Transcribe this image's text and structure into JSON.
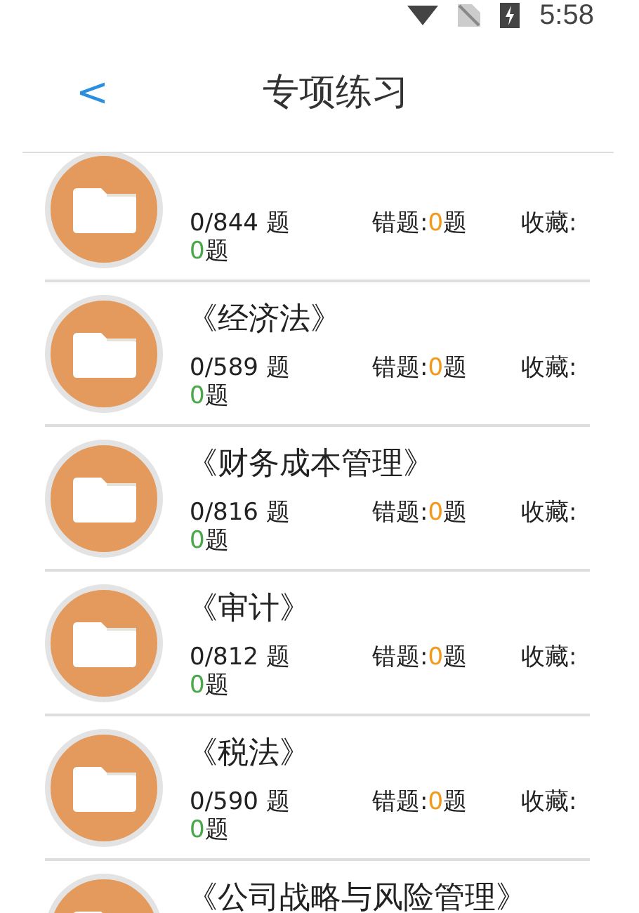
{
  "status_bar": {
    "time": "5:58"
  },
  "header": {
    "back": "<",
    "title": "专项练习"
  },
  "subjects": [
    {
      "done": "0/844 题",
      "wrong": {
        "label": "错题:",
        "count": "0",
        "unit": "题"
      },
      "favorites": {
        "label": "收藏:",
        "count": "0",
        "unit": "题"
      }
    },
    {
      "title": "《经济法》",
      "done": "0/589 题",
      "wrong": {
        "label": "错题:",
        "count": "0",
        "unit": "题"
      },
      "favorites": {
        "label": "收藏:",
        "count": "0",
        "unit": "题"
      }
    },
    {
      "title": "《财务成本管理》",
      "done": "0/816 题",
      "wrong": {
        "label": "错题:",
        "count": "0",
        "unit": "题"
      },
      "favorites": {
        "label": "收藏:",
        "count": "0",
        "unit": "题"
      }
    },
    {
      "title": "《审计》",
      "done": "0/812 题",
      "wrong": {
        "label": "错题:",
        "count": "0",
        "unit": "题"
      },
      "favorites": {
        "label": "收藏:",
        "count": "0",
        "unit": "题"
      }
    },
    {
      "title": "《税法》",
      "done": "0/590 题",
      "wrong": {
        "label": "错题:",
        "count": "0",
        "unit": "题"
      },
      "favorites": {
        "label": "收藏:",
        "count": "0",
        "unit": "题"
      }
    },
    {
      "title": "《公司战略与风险管理》"
    }
  ]
}
